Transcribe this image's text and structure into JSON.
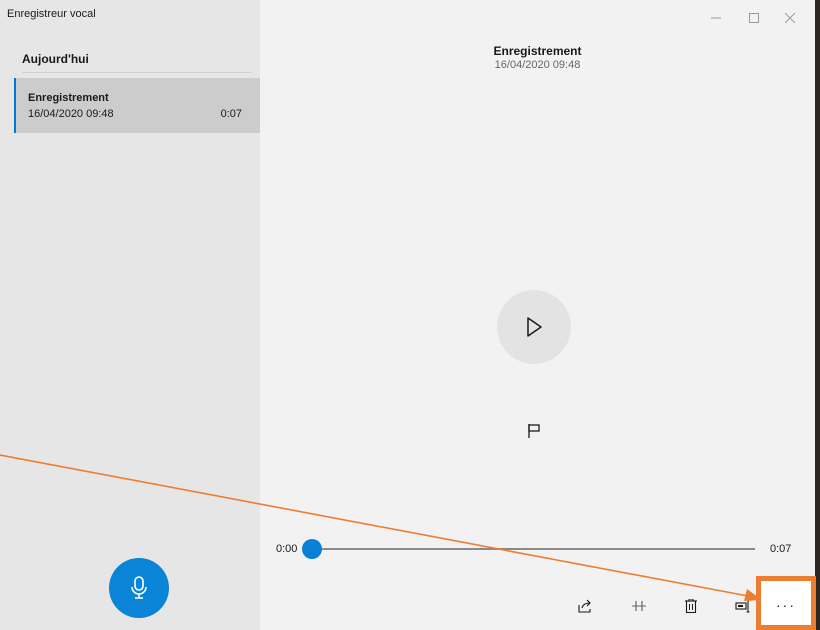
{
  "app": {
    "title": "Enregistreur vocal"
  },
  "sidebar": {
    "group_header": "Aujourd'hui",
    "recordings": [
      {
        "name": "Enregistrement",
        "date": "16/04/2020 09:48",
        "duration": "0:07",
        "selected": true
      }
    ],
    "record_button_icon": "microphone-icon"
  },
  "window_controls": {
    "minimize": "—",
    "maximize": "☐",
    "close": "✕"
  },
  "detail": {
    "title": "Enregistrement",
    "date": "16/04/2020 09:48",
    "play_icon": "play-icon",
    "marker_icon": "flag-icon"
  },
  "player": {
    "time_start": "0:00",
    "time_end": "0:07",
    "progress": 0.0
  },
  "toolbar": {
    "items": [
      "share-icon",
      "trim-icon",
      "delete-icon",
      "rename-icon"
    ],
    "more_label": "···"
  },
  "colors": {
    "accent": "#0078d7",
    "annotation": "#ed7d31",
    "sidebar_bg": "#e6e6e6",
    "main_bg": "#f2f2f2"
  }
}
